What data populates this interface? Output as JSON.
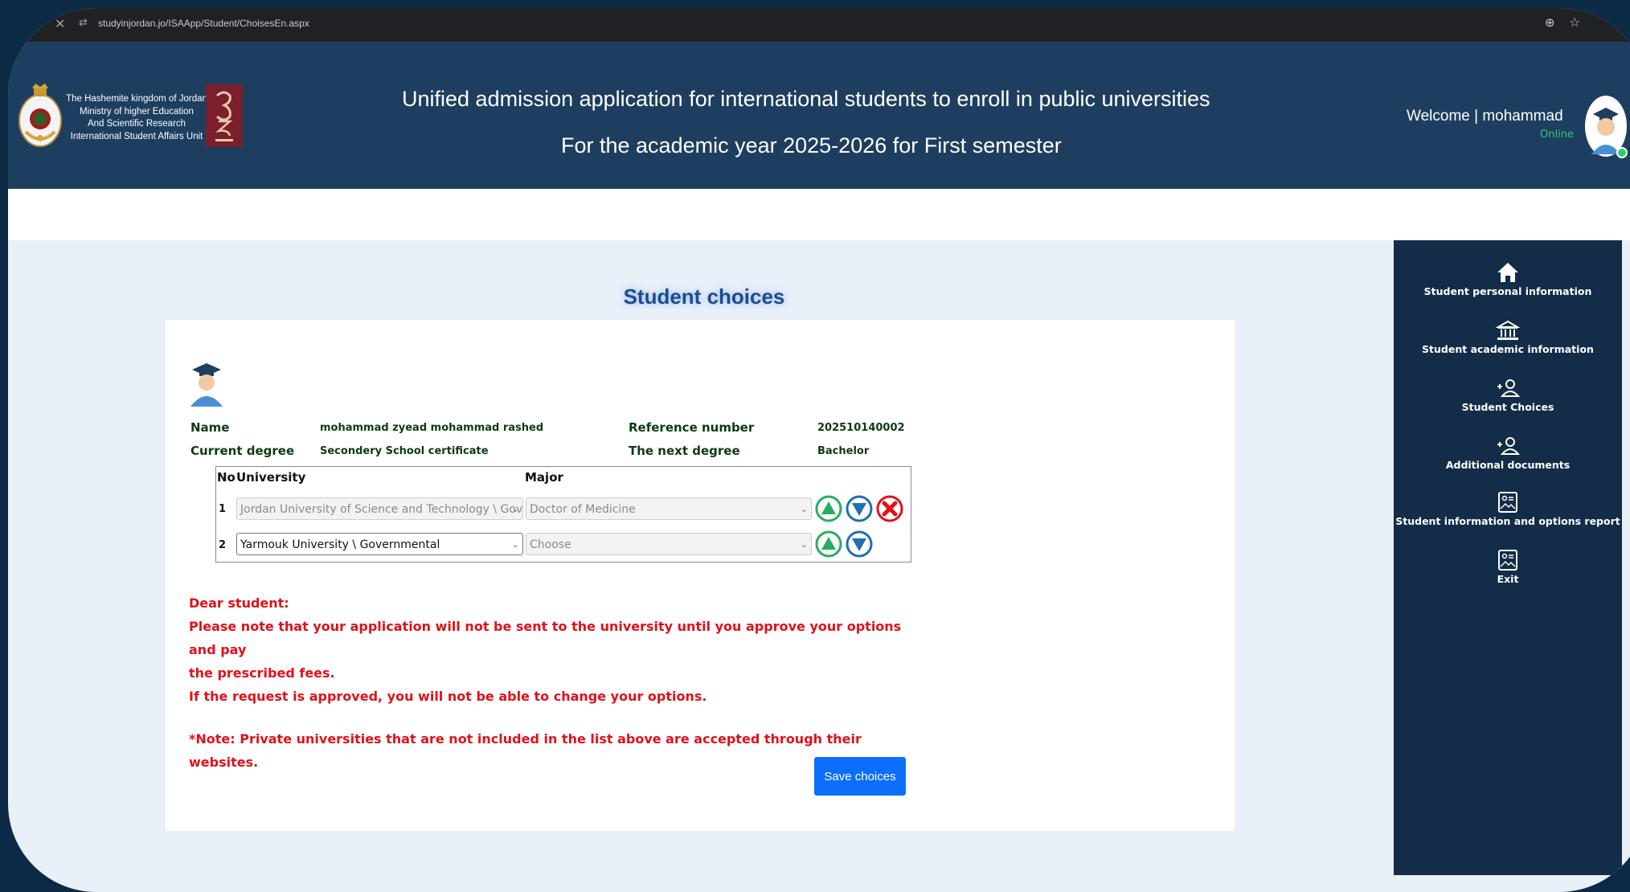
{
  "browser": {
    "url": "studyinjordan.jo/ISAApp/Student/ChoisesEn.aspx"
  },
  "header": {
    "ministry_lines": [
      "The Hashemite kingdom of Jordan",
      "Ministry of higher Education",
      "And Scientific Research",
      "International Student Affairs Unit"
    ],
    "title_line1": "Unified admission application for international students to enroll in public universities",
    "title_line2": "For the academic year 2025-2026 for First semester",
    "welcome": "Welcome | mohammad",
    "status": "Online"
  },
  "sidebar": {
    "items": [
      {
        "label": "Student personal information",
        "icon": "home-icon"
      },
      {
        "label": "Student academic information",
        "icon": "institution-icon"
      },
      {
        "label": "Student Choices",
        "icon": "add-user-icon"
      },
      {
        "label": "Additional documents",
        "icon": "add-user-icon"
      },
      {
        "label": "Student information and options report",
        "icon": "report-icon"
      },
      {
        "label": "Exit",
        "icon": "report-icon"
      }
    ]
  },
  "main": {
    "page_title": "Student choices",
    "student": {
      "name_label": "Name",
      "name_value": "mohammad zyead mohammad rashed",
      "reference_label": "Reference number",
      "reference_value": "202510140002",
      "current_degree_label": "Current degree",
      "current_degree_value": "Secondery School certificate",
      "next_degree_label": "The next degree",
      "next_degree_value": "Bachelor"
    },
    "table": {
      "headers": {
        "no": "No",
        "university": "University",
        "major": "Major"
      },
      "rows": [
        {
          "no": "1",
          "university": "Jordan University of Science and Technology \\ Governmental",
          "major": "Doctor of Medicine"
        },
        {
          "no": "2",
          "university": "Yarmouk University \\ Governmental",
          "major": "Choose"
        }
      ]
    },
    "notes": {
      "greeting": "Dear student:",
      "line1": "Please note that your application will not be sent to the university until you approve your options and pay",
      "line2": "the prescribed fees.",
      "line3": "If the request is approved, you will not be able to change your options.",
      "line4": "*Note: Private universities that are not included in the list above are accepted through their websites."
    },
    "save_label": "Save choices"
  },
  "colors": {
    "header_bg": "#1e3e60",
    "sidebar_bg": "#132c48",
    "page_bg": "#e9f0f8",
    "note_red": "#e0111b",
    "info_green": "#0d3b10",
    "primary_button": "#0d6efd",
    "up_button": "#27ae60",
    "down_button": "#1f6fb2",
    "delete_button": "#e0111b"
  }
}
